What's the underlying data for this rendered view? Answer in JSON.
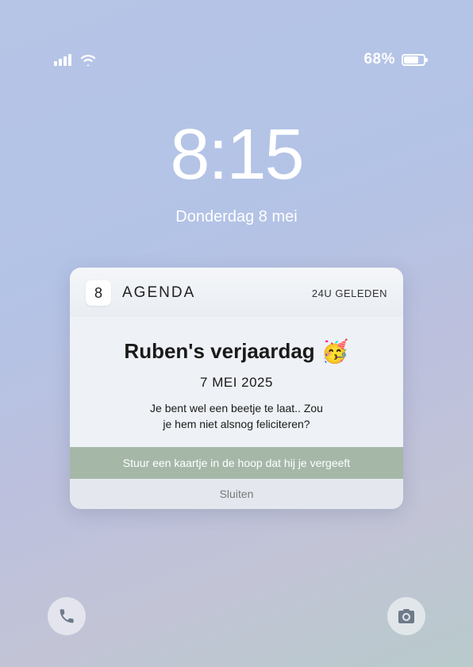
{
  "status": {
    "battery_text": "68%"
  },
  "clock": {
    "time": "8:15",
    "date": "Donderdag 8 mei"
  },
  "notification": {
    "badge_day": "8",
    "app_name": "AGENDA",
    "time_ago": "24U GELEDEN",
    "title": "Ruben's verjaardag",
    "emoji": "🥳",
    "date": "7 MEI 2025",
    "message_line1": "Je bent wel een beetje te laat.. Zou",
    "message_line2": "je hem niet alsnog feliciteren?",
    "action_label": "Stuur een kaartje in de hoop dat hij je vergeeft",
    "close_label": "Sluiten"
  }
}
